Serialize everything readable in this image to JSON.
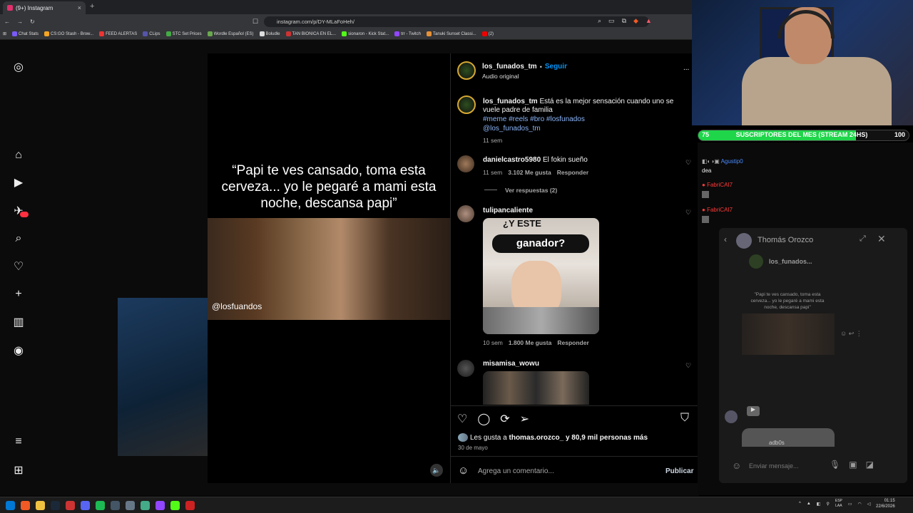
{
  "browser": {
    "tab_title": "(9+) Instagram",
    "tab_close": "×",
    "new_tab": "+",
    "url": "instagram.com/p/DY-MLaFoHeh/",
    "bookmarks": [
      "Chat Stats",
      "CS:GO Stash - Brow...",
      "FEED ALERTAS",
      "CLips",
      "STC Set Prices",
      "Wordle Español (ES)",
      "Boludle",
      "TAN BIONICA EN EL...",
      "sionaron - Kick Stat...",
      "trr - Twitch",
      "Tanuki Sunset Classi...",
      "(2)"
    ]
  },
  "colors": {
    "accent": "#0095f6",
    "link": "#8ab4f8",
    "sub_green": "#1fd64a"
  },
  "video": {
    "quote": "“Papi te ves cansado, toma esta cerveza... yo le pegaré a mami esta noche, descansa papi”",
    "handle": "@losfuandos"
  },
  "post": {
    "author": "los_funados_tm",
    "separator": "•",
    "follow": "Seguir",
    "audio": "Audio original",
    "more": "...",
    "caption_text": "Está es la mejor sensación cuando uno se vuele padre de familia",
    "hashtags": "#meme #reels #bro #losfunados",
    "mention": "@los_funados_tm",
    "caption_time": "11 sem",
    "likes_prefix": "Les gusta a",
    "likes_user": "thomas.orozco_",
    "likes_suffix": "y 80,9 mil personas más",
    "date": "30 de mayo",
    "comment_placeholder": "Agrega un comentario...",
    "publish": "Publicar"
  },
  "comments": [
    {
      "user": "danielcastro5980",
      "text": "El fokin sueño",
      "time": "11 sem",
      "likes": "3.102 Me gusta",
      "reply": "Responder",
      "view_replies": "Ver respuestas (2)"
    },
    {
      "user": "tulipancaliente",
      "gif_caption_top": "¿Y ESTE",
      "gif_caption": "ganador?",
      "time": "10 sem",
      "likes": "1.800 Me gusta",
      "reply": "Responder"
    },
    {
      "user": "misamisa_wowu"
    }
  ],
  "stream": {
    "sub_current": "75",
    "sub_goal": "100",
    "sub_progress": 0.75,
    "sub_label": "SUSCRIPTORES DEL MES (STREAM 24HS)",
    "chat": [
      {
        "user": "Agustip0",
        "color": "#4a8cff"
      },
      {
        "msg": "dea"
      },
      {
        "user": "FabriCAI7",
        "color": "#ff3a3a"
      },
      {
        "user": "FabriCAI7",
        "color": "#ff3a3a"
      }
    ],
    "dm": {
      "title": "Thomás Orozco",
      "shared_user": "los_funados...",
      "shared_quote": "\"Papi te ves cansado, toma esta cerveza... yo le pegaré a mami esta noche, descansa papi\"",
      "other_user": "adb0s",
      "input_placeholder": "Enviar mensaje..."
    }
  },
  "taskbar": {
    "lang1": "ESP",
    "lang2": "LAA",
    "time": "01:15",
    "date": "22/6/2026"
  }
}
